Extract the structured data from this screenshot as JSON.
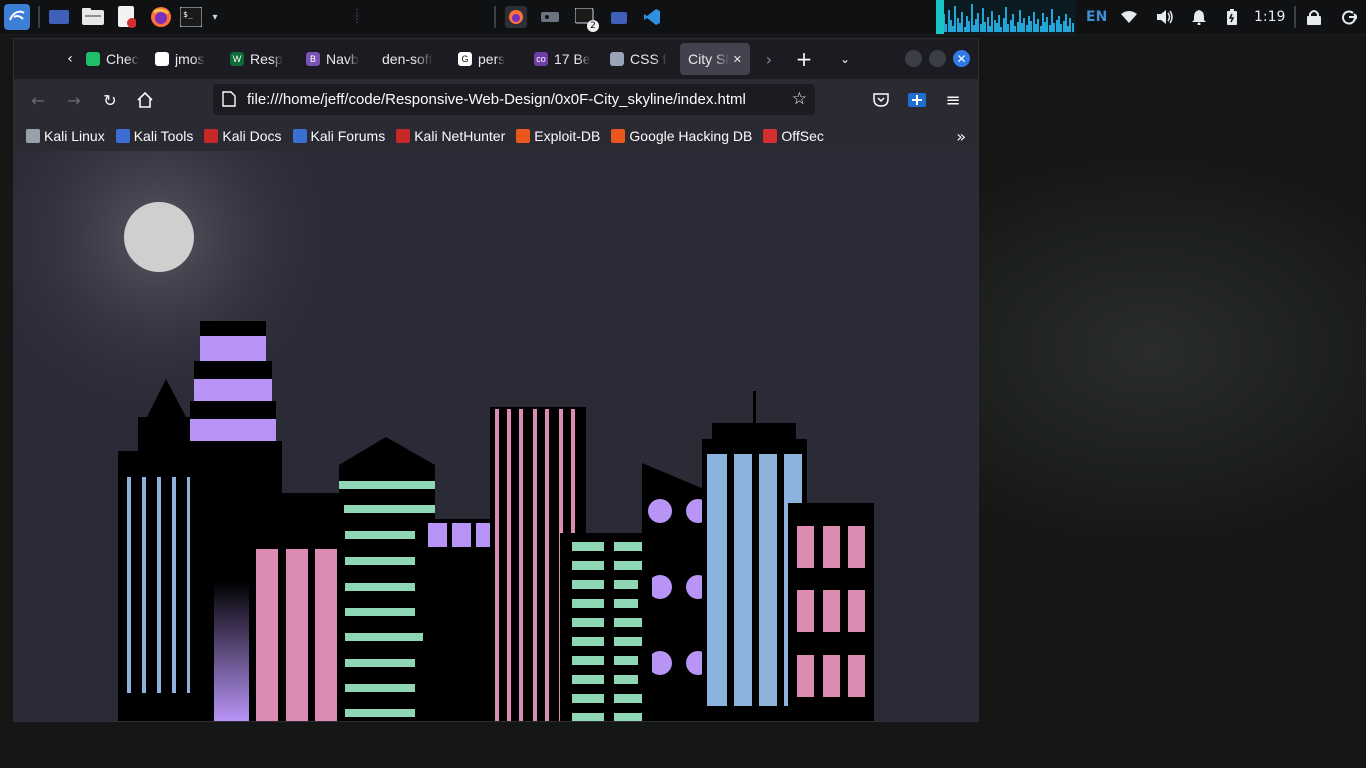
{
  "taskbar": {
    "launchers": [
      "kali-menu-icon",
      "workspace-icon",
      "file-manager-icon",
      "text-editor-icon",
      "firefox-icon",
      "terminal-icon"
    ],
    "running_apps": [
      "firefox-running-icon",
      "screen-recorder-icon",
      "terminal-running-icon",
      "folder-running-icon",
      "vscode-icon"
    ],
    "terminal_count": "2",
    "keyboard_layout": "EN",
    "clock": "1:19",
    "colors": {
      "bg": "#101113",
      "accent": "#22a6d8"
    }
  },
  "browser": {
    "tabs": [
      {
        "label": "Chec",
        "favicon_color": "#1fbf6a",
        "favicon_text": ""
      },
      {
        "label": "jmos",
        "favicon_color": "#ffffff",
        "favicon_text": ""
      },
      {
        "label": "Resp",
        "favicon_color": "#0d6b3a",
        "favicon_text": "W"
      },
      {
        "label": "Navb",
        "favicon_color": "#7952b3",
        "favicon_text": "B"
      },
      {
        "label": "den-soft",
        "favicon_color": "",
        "favicon_text": ""
      },
      {
        "label": "pers",
        "favicon_color": "#ffffff",
        "favicon_text": "G"
      },
      {
        "label": "17 Be",
        "favicon_color": "#6d3fa6",
        "favicon_text": "co"
      },
      {
        "label": "CSS f",
        "favicon_color": "#9aa4b8",
        "favicon_text": ""
      },
      {
        "label": "City Sk",
        "favicon_color": "",
        "favicon_text": ""
      }
    ],
    "active_tab_index": 8,
    "url": "file:///home/jeff/code/Responsive-Web-Design/0x0F-City_skyline/index.html",
    "bookmarks": [
      {
        "label": "Kali Linux",
        "color": "#9aa0ab"
      },
      {
        "label": "Kali Tools",
        "color": "#3b6fd4"
      },
      {
        "label": "Kali Docs",
        "color": "#c62828"
      },
      {
        "label": "Kali Forums",
        "color": "#3b6fd4"
      },
      {
        "label": "Kali NetHunter",
        "color": "#c62828"
      },
      {
        "label": "Exploit-DB",
        "color": "#e8581c"
      },
      {
        "label": "Google Hacking DB",
        "color": "#e8581c"
      },
      {
        "label": "OffSec",
        "color": "#d32f2f"
      }
    ]
  },
  "scene": {
    "colors": {
      "sky": "#2b2a37",
      "moon": "#cfcfcf",
      "building": "#000000",
      "blue": "#8cb3de",
      "pink": "#dc8bb2",
      "purple": "#b794f6",
      "green": "#8fd6b4"
    }
  }
}
